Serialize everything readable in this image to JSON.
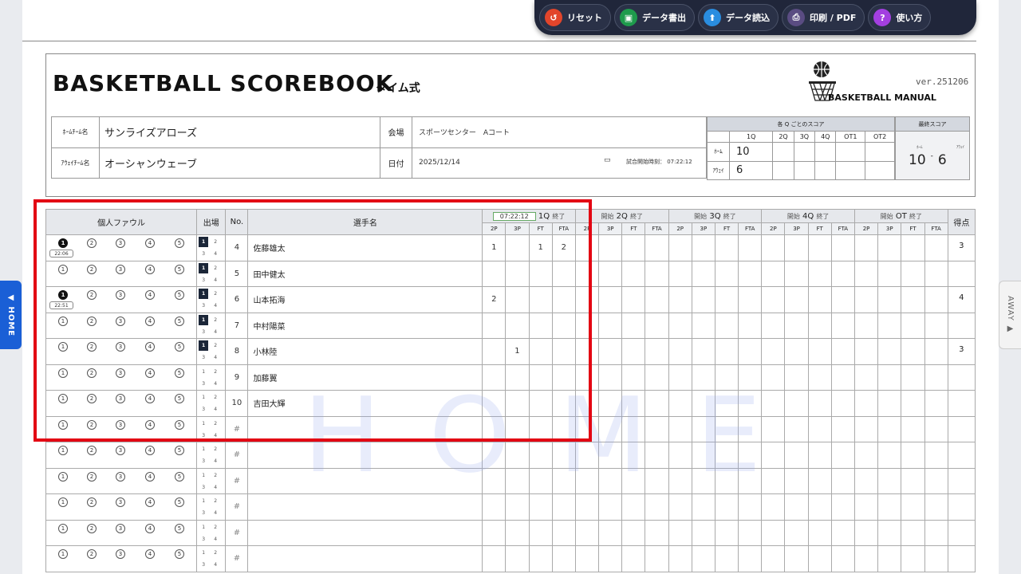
{
  "toolbar": {
    "reset": "リセット",
    "export": "データ書出",
    "import": "データ読込",
    "print": "印刷 / PDF",
    "help": "使い方",
    "colors": {
      "reset": "#e2452b",
      "export": "#1e9b4c",
      "import": "#2a8de0",
      "print": "#5a4c82",
      "help": "#a33fe0"
    }
  },
  "header": {
    "title": "BASKETBALL SCOREBOOK",
    "subtitle": "タイム式",
    "logo_text": "BASKETBALL MANUAL",
    "version": "ver.251206"
  },
  "teams": {
    "home_label": "ﾎｰﾑﾁｰﾑ名",
    "home_name": "サンライズアローズ",
    "away_label": "ｱｳｪｲﾁｰﾑ名",
    "away_name": "オーシャンウェーブ",
    "venue_label": "会場",
    "venue": "スポーツセンター　Aコート",
    "date_label": "日付",
    "date": "2025/12/14",
    "start_time_label": "試合開始時刻： 07:22:12"
  },
  "quarter_score": {
    "title": "各 Q ごとのスコア",
    "cols": [
      "1Q",
      "2Q",
      "3Q",
      "4Q",
      "OT1",
      "OT2"
    ],
    "home_label": "ﾎｰﾑ",
    "away_label": "ｱｳｪｲ",
    "home": [
      "10",
      "",
      "",
      "",
      "",
      ""
    ],
    "away": [
      "6",
      "",
      "",
      "",
      "",
      ""
    ]
  },
  "final_score": {
    "title": "最終スコア",
    "home_label": "ﾎｰﾑ",
    "away_label": "ｱｳｪｲ",
    "home": "10",
    "away": "6",
    "sep": "-"
  },
  "table": {
    "foul_header": "個人ファウル",
    "part_header": "出場",
    "no_header": "No.",
    "name_header": "選手名",
    "total_header": "得点",
    "quarter_time": "07:22:12",
    "start_label": "開始",
    "end_label": "終了",
    "quarters": [
      "1Q",
      "2Q",
      "3Q",
      "4Q",
      "OT"
    ],
    "sub_cols": [
      "2P",
      "3P",
      "FT",
      "FTA"
    ]
  },
  "players": [
    {
      "fouls": 1,
      "foul_time": "22:06",
      "quarters": [
        1
      ],
      "no": "4",
      "name": "佐藤雄太",
      "q1": [
        "1",
        "",
        "1",
        "2"
      ],
      "total": "3"
    },
    {
      "fouls": 0,
      "foul_time": "",
      "quarters": [
        1
      ],
      "no": "5",
      "name": "田中健太",
      "q1": [
        "",
        "",
        "",
        ""
      ],
      "total": ""
    },
    {
      "fouls": 1,
      "foul_time": "22:51",
      "quarters": [
        1
      ],
      "no": "6",
      "name": "山本拓海",
      "q1": [
        "2",
        "",
        "",
        ""
      ],
      "total": "4"
    },
    {
      "fouls": 0,
      "foul_time": "",
      "quarters": [
        1
      ],
      "no": "7",
      "name": "中村陽菜",
      "q1": [
        "",
        "",
        "",
        ""
      ],
      "total": ""
    },
    {
      "fouls": 0,
      "foul_time": "",
      "quarters": [
        1
      ],
      "no": "8",
      "name": "小林陸",
      "q1": [
        "",
        "1",
        "",
        ""
      ],
      "total": "3"
    },
    {
      "fouls": 0,
      "foul_time": "",
      "quarters": [],
      "no": "9",
      "name": "加藤翼",
      "q1": [
        "",
        "",
        "",
        ""
      ],
      "total": ""
    },
    {
      "fouls": 0,
      "foul_time": "",
      "quarters": [],
      "no": "10",
      "name": "吉田大輝",
      "q1": [
        "",
        "",
        "",
        ""
      ],
      "total": ""
    },
    {
      "fouls": 0,
      "foul_time": "",
      "quarters": [],
      "no": "#",
      "name": "",
      "q1": [
        "",
        "",
        "",
        ""
      ],
      "total": ""
    },
    {
      "fouls": 0,
      "foul_time": "",
      "quarters": [],
      "no": "#",
      "name": "",
      "q1": [
        "",
        "",
        "",
        ""
      ],
      "total": ""
    },
    {
      "fouls": 0,
      "foul_time": "",
      "quarters": [],
      "no": "#",
      "name": "",
      "q1": [
        "",
        "",
        "",
        ""
      ],
      "total": ""
    },
    {
      "fouls": 0,
      "foul_time": "",
      "quarters": [],
      "no": "#",
      "name": "",
      "q1": [
        "",
        "",
        "",
        ""
      ],
      "total": ""
    },
    {
      "fouls": 0,
      "foul_time": "",
      "quarters": [],
      "no": "#",
      "name": "",
      "q1": [
        "",
        "",
        "",
        ""
      ],
      "total": ""
    },
    {
      "fouls": 0,
      "foul_time": "",
      "quarters": [],
      "no": "#",
      "name": "",
      "q1": [
        "",
        "",
        "",
        ""
      ],
      "total": ""
    }
  ],
  "watermark": "HOME",
  "side_tabs": {
    "home": "◀ HOME",
    "away": "AWAY ▶"
  }
}
